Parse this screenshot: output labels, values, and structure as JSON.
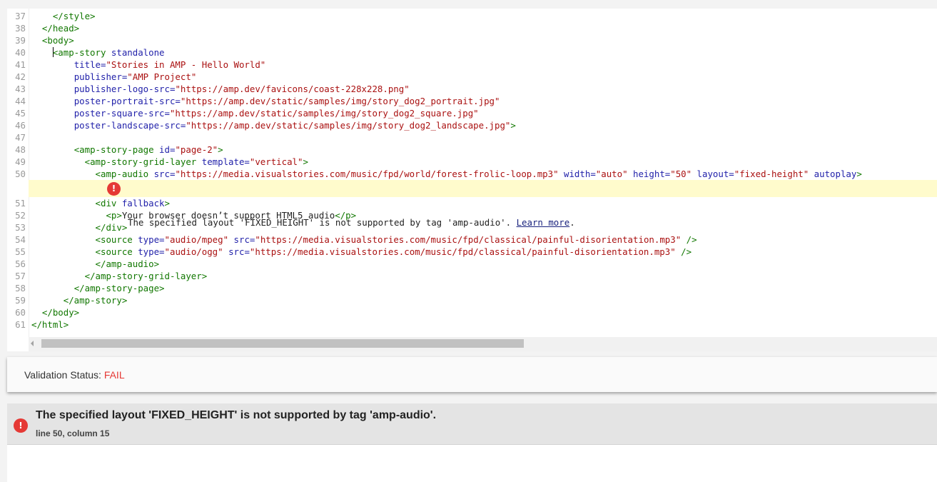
{
  "editor": {
    "lines_before": [
      {
        "n": "37",
        "parts": [
          [
            "pl",
            "    "
          ],
          [
            "tg",
            "</style>"
          ]
        ]
      },
      {
        "n": "38",
        "parts": [
          [
            "pl",
            "  "
          ],
          [
            "tg",
            "</head>"
          ]
        ]
      },
      {
        "n": "39",
        "parts": [
          [
            "pl",
            "  "
          ],
          [
            "tg",
            "<body>"
          ]
        ]
      },
      {
        "n": "40",
        "cursor": true,
        "parts": [
          [
            "pl",
            "    "
          ],
          [
            "tg",
            "<amp-story "
          ],
          [
            "at",
            "standalone"
          ]
        ]
      },
      {
        "n": "41",
        "parts": [
          [
            "pl",
            "        "
          ],
          [
            "at",
            "title="
          ],
          [
            "st",
            "\"Stories in AMP - Hello World\""
          ]
        ]
      },
      {
        "n": "42",
        "parts": [
          [
            "pl",
            "        "
          ],
          [
            "at",
            "publisher="
          ],
          [
            "st",
            "\"AMP Project\""
          ]
        ]
      },
      {
        "n": "43",
        "parts": [
          [
            "pl",
            "        "
          ],
          [
            "at",
            "publisher-logo-src="
          ],
          [
            "st",
            "\"https://amp.dev/favicons/coast-228x228.png\""
          ]
        ]
      },
      {
        "n": "44",
        "parts": [
          [
            "pl",
            "        "
          ],
          [
            "at",
            "poster-portrait-src="
          ],
          [
            "st",
            "\"https://amp.dev/static/samples/img/story_dog2_portrait.jpg\""
          ]
        ]
      },
      {
        "n": "45",
        "parts": [
          [
            "pl",
            "        "
          ],
          [
            "at",
            "poster-square-src="
          ],
          [
            "st",
            "\"https://amp.dev/static/samples/img/story_dog2_square.jpg\""
          ]
        ]
      },
      {
        "n": "46",
        "parts": [
          [
            "pl",
            "        "
          ],
          [
            "at",
            "poster-landscape-src="
          ],
          [
            "st",
            "\"https://amp.dev/static/samples/img/story_dog2_landscape.jpg\""
          ],
          [
            "tg",
            ">"
          ]
        ]
      },
      {
        "n": "47",
        "parts": []
      },
      {
        "n": "48",
        "parts": [
          [
            "pl",
            "        "
          ],
          [
            "tg",
            "<amp-story-page "
          ],
          [
            "at",
            "id="
          ],
          [
            "st",
            "\"page-2\""
          ],
          [
            "tg",
            ">"
          ]
        ]
      },
      {
        "n": "49",
        "parts": [
          [
            "pl",
            "          "
          ],
          [
            "tg",
            "<amp-story-grid-layer "
          ],
          [
            "at",
            "template="
          ],
          [
            "st",
            "\"vertical\""
          ],
          [
            "tg",
            ">"
          ]
        ]
      },
      {
        "n": "50",
        "parts": [
          [
            "pl",
            "            "
          ],
          [
            "tg",
            "<amp-audio "
          ],
          [
            "at",
            "src="
          ],
          [
            "st",
            "\"https://media.visualstories.com/music/fpd/world/forest-frolic-loop.mp3\""
          ],
          [
            "pl",
            " "
          ],
          [
            "at",
            "width="
          ],
          [
            "st",
            "\"auto\""
          ],
          [
            "pl",
            " "
          ],
          [
            "at",
            "height="
          ],
          [
            "st",
            "\"50\""
          ],
          [
            "pl",
            " "
          ],
          [
            "at",
            "layout="
          ],
          [
            "st",
            "\"fixed-height\""
          ],
          [
            "pl",
            " "
          ],
          [
            "at",
            "autoplay"
          ],
          [
            "tg",
            ">"
          ]
        ]
      }
    ],
    "inline_error": {
      "message": "The specified layout 'FIXED_HEIGHT' is not supported by tag 'amp-audio'.",
      "learn_more": "Learn more",
      "trailing": "."
    },
    "lines_after": [
      {
        "n": "51",
        "parts": [
          [
            "pl",
            "            "
          ],
          [
            "tg",
            "<div "
          ],
          [
            "at",
            "fallback"
          ],
          [
            "tg",
            ">"
          ]
        ]
      },
      {
        "n": "52",
        "parts": [
          [
            "pl",
            "              "
          ],
          [
            "tg",
            "<p>"
          ],
          [
            "pl",
            "Your browser doesn’t support HTML5 audio"
          ],
          [
            "tg",
            "</p>"
          ]
        ]
      },
      {
        "n": "53",
        "parts": [
          [
            "pl",
            "            "
          ],
          [
            "tg",
            "</div>"
          ]
        ]
      },
      {
        "n": "54",
        "parts": [
          [
            "pl",
            "            "
          ],
          [
            "tg",
            "<source "
          ],
          [
            "at",
            "type="
          ],
          [
            "st",
            "\"audio/mpeg\""
          ],
          [
            "pl",
            " "
          ],
          [
            "at",
            "src="
          ],
          [
            "st",
            "\"https://media.visualstories.com/music/fpd/classical/painful-disorientation.mp3\""
          ],
          [
            "pl",
            " "
          ],
          [
            "tg",
            "/>"
          ]
        ]
      },
      {
        "n": "55",
        "parts": [
          [
            "pl",
            "            "
          ],
          [
            "tg",
            "<source "
          ],
          [
            "at",
            "type="
          ],
          [
            "st",
            "\"audio/ogg\""
          ],
          [
            "pl",
            " "
          ],
          [
            "at",
            "src="
          ],
          [
            "st",
            "\"https://media.visualstories.com/music/fpd/classical/painful-disorientation.mp3\""
          ],
          [
            "pl",
            " "
          ],
          [
            "tg",
            "/>"
          ]
        ]
      },
      {
        "n": "56",
        "parts": [
          [
            "pl",
            "            "
          ],
          [
            "tg",
            "</amp-audio>"
          ]
        ]
      },
      {
        "n": "57",
        "parts": [
          [
            "pl",
            "          "
          ],
          [
            "tg",
            "</amp-story-grid-layer>"
          ]
        ]
      },
      {
        "n": "58",
        "parts": [
          [
            "pl",
            "        "
          ],
          [
            "tg",
            "</amp-story-page>"
          ]
        ]
      },
      {
        "n": "59",
        "parts": [
          [
            "pl",
            "      "
          ],
          [
            "tg",
            "</amp-story>"
          ]
        ]
      },
      {
        "n": "60",
        "parts": [
          [
            "pl",
            "  "
          ],
          [
            "tg",
            "</body>"
          ]
        ]
      },
      {
        "n": "61",
        "parts": [
          [
            "tg",
            "</html>"
          ]
        ]
      }
    ]
  },
  "validation": {
    "label": "Validation Status: ",
    "value": "FAIL"
  },
  "errors": [
    {
      "icon": "error-icon",
      "title": "The specified layout 'FIXED_HEIGHT' is not supported by tag 'amp-audio'.",
      "location": "line 50, column 15"
    }
  ],
  "colors": {
    "tag": "#117700",
    "attribute": "#2222aa",
    "string": "#aa1111",
    "error": "#e53935",
    "error_line_bg": "#fffbcc"
  }
}
